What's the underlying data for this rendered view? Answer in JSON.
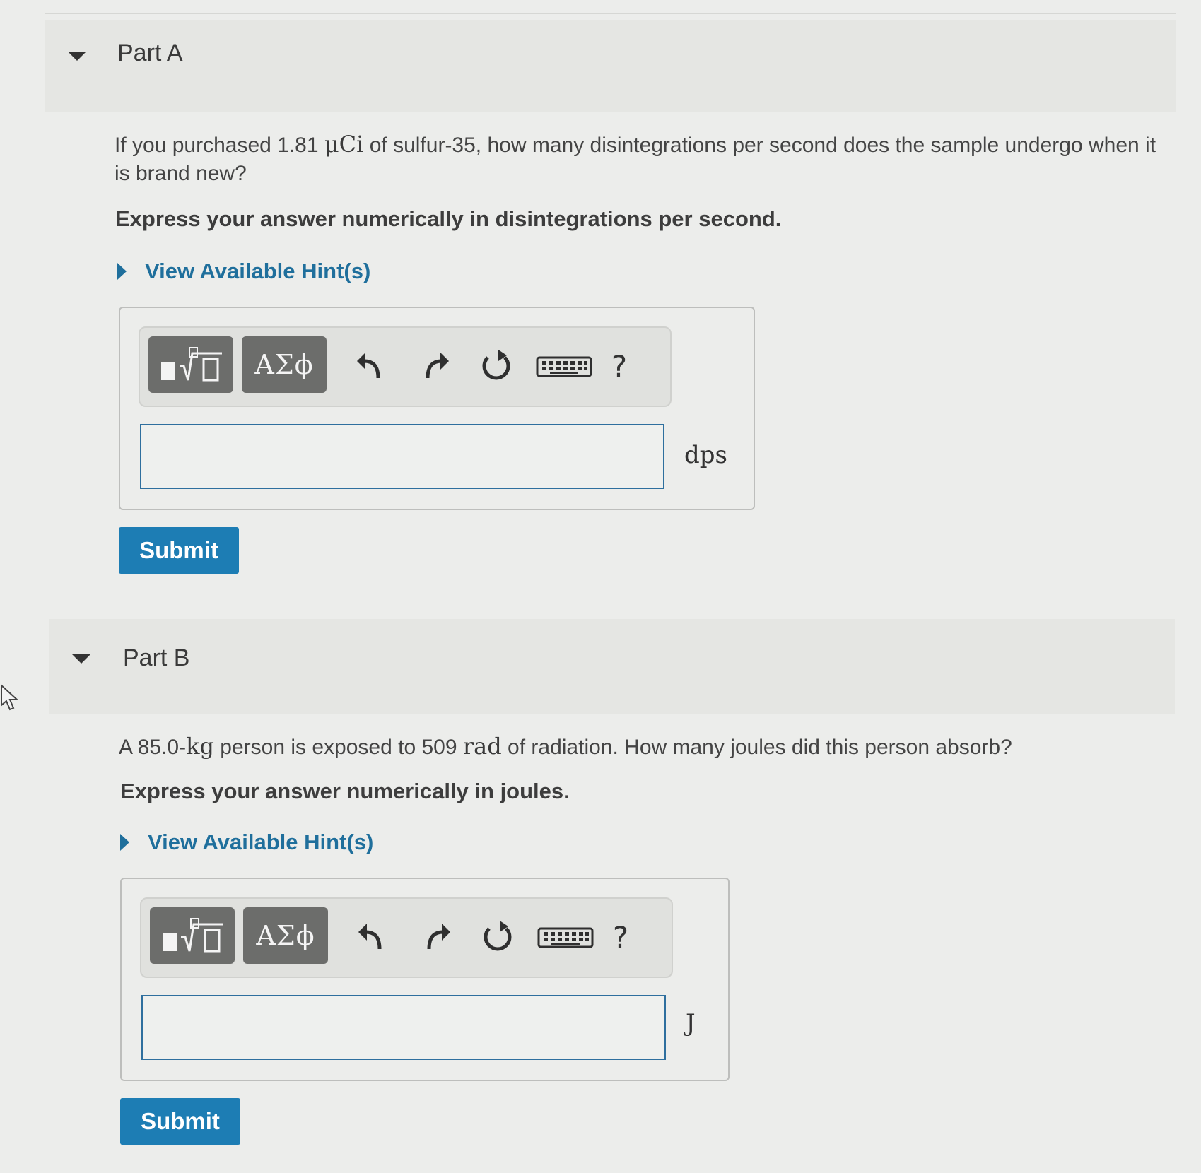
{
  "part_a": {
    "title": "Part A",
    "question_pre": "If you purchased 1.81 ",
    "question_math": "μCi",
    "question_post": " of sulfur-35, how many disintegrations per second does the sample undergo when it is brand new?",
    "instruction": "Express your answer numerically in disintegrations per second.",
    "hints_label": "View Available Hint(s)",
    "greek_label": "ΑΣϕ",
    "help_label": "?",
    "answer_value": "",
    "unit": "dps",
    "submit_label": "Submit"
  },
  "part_b": {
    "title": "Part B",
    "question_pre": "A 85.0-",
    "question_math1": "kg",
    "question_mid": " person is exposed to 509 ",
    "question_math2": "rad",
    "question_post": " of radiation. How many joules did this person absorb?",
    "instruction": "Express your answer numerically in joules.",
    "hints_label": "View Available Hint(s)",
    "greek_label": "ΑΣϕ",
    "help_label": "?",
    "answer_value": "",
    "unit": "J",
    "submit_label": "Submit"
  },
  "icons": [
    "caret-down-icon",
    "templates-icon",
    "greek-letters-icon",
    "undo-icon",
    "redo-icon",
    "reset-icon",
    "keyboard-icon",
    "help-icon",
    "cursor-arrow-icon"
  ]
}
